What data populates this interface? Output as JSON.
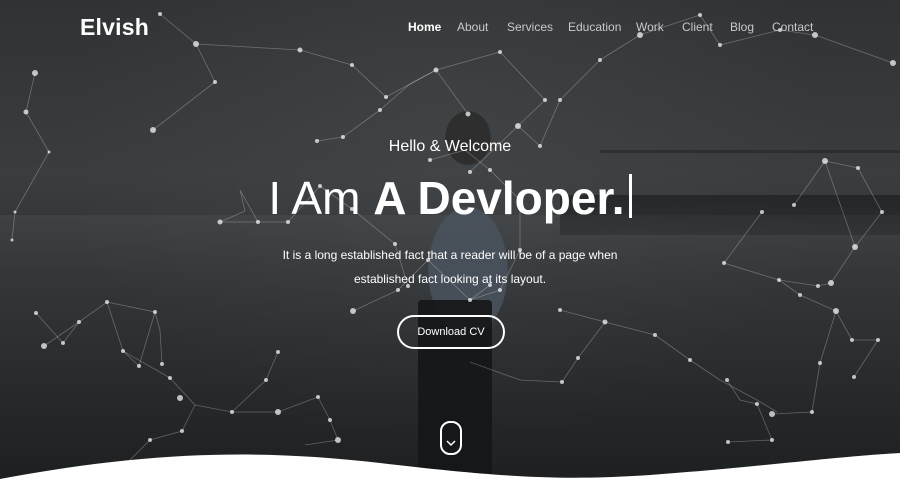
{
  "header": {
    "brand": "Elvish",
    "nav": [
      {
        "label": "Home",
        "active": true
      },
      {
        "label": "About",
        "active": false
      },
      {
        "label": "Services",
        "active": false
      },
      {
        "label": "Education",
        "active": false
      },
      {
        "label": "Work",
        "active": false
      },
      {
        "label": "Client",
        "active": false
      },
      {
        "label": "Blog",
        "active": false
      },
      {
        "label": "Contact",
        "active": false
      }
    ]
  },
  "hero": {
    "greeting": "Hello & Welcome",
    "headline_prefix": "I Am ",
    "headline_highlight": "A Devloper.",
    "description_line1": "It is a long established fact that a reader will be of a page when",
    "description_line2": "established fact looking at its layout.",
    "cta_label": "Download CV",
    "scroll_icon": "chevron-down-icon"
  },
  "colors": {
    "text": "#ffffff",
    "nav_inactive": "#c7c9ca",
    "background": "#2c2f30",
    "wave": "#ffffff"
  }
}
